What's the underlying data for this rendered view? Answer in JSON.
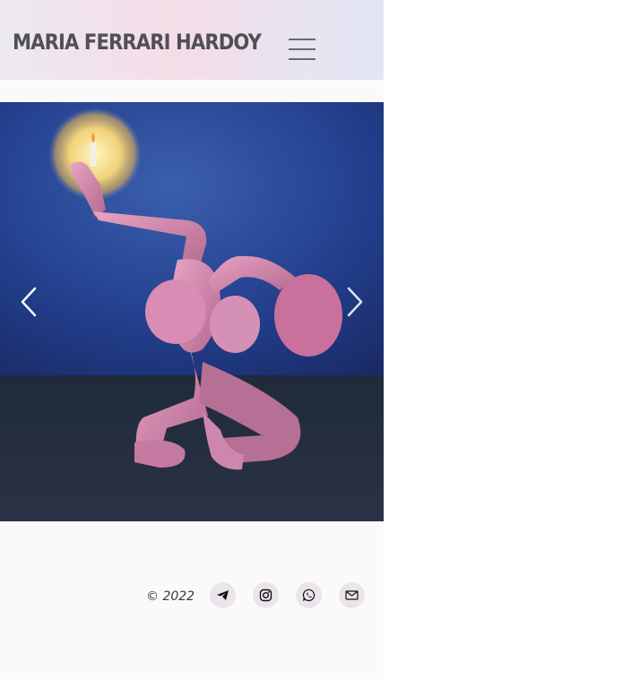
{
  "header": {
    "site_title": "MARIA FERRARI HARDOY",
    "menu_icon": "hamburger-menu-icon"
  },
  "gallery": {
    "artwork_description": "",
    "prev_icon": "chevron-left-icon",
    "next_icon": "chevron-right-icon"
  },
  "footer": {
    "copyright": "© 2022",
    "social_icons": [
      "telegram-icon",
      "instagram-icon",
      "whatsapp-icon",
      "email-icon"
    ]
  },
  "colors": {
    "header_gradient": [
      "#ece9f0",
      "#f5dde8",
      "#e2e6f3"
    ],
    "icon_bg": "#ebe4ea",
    "title": "#505055"
  }
}
